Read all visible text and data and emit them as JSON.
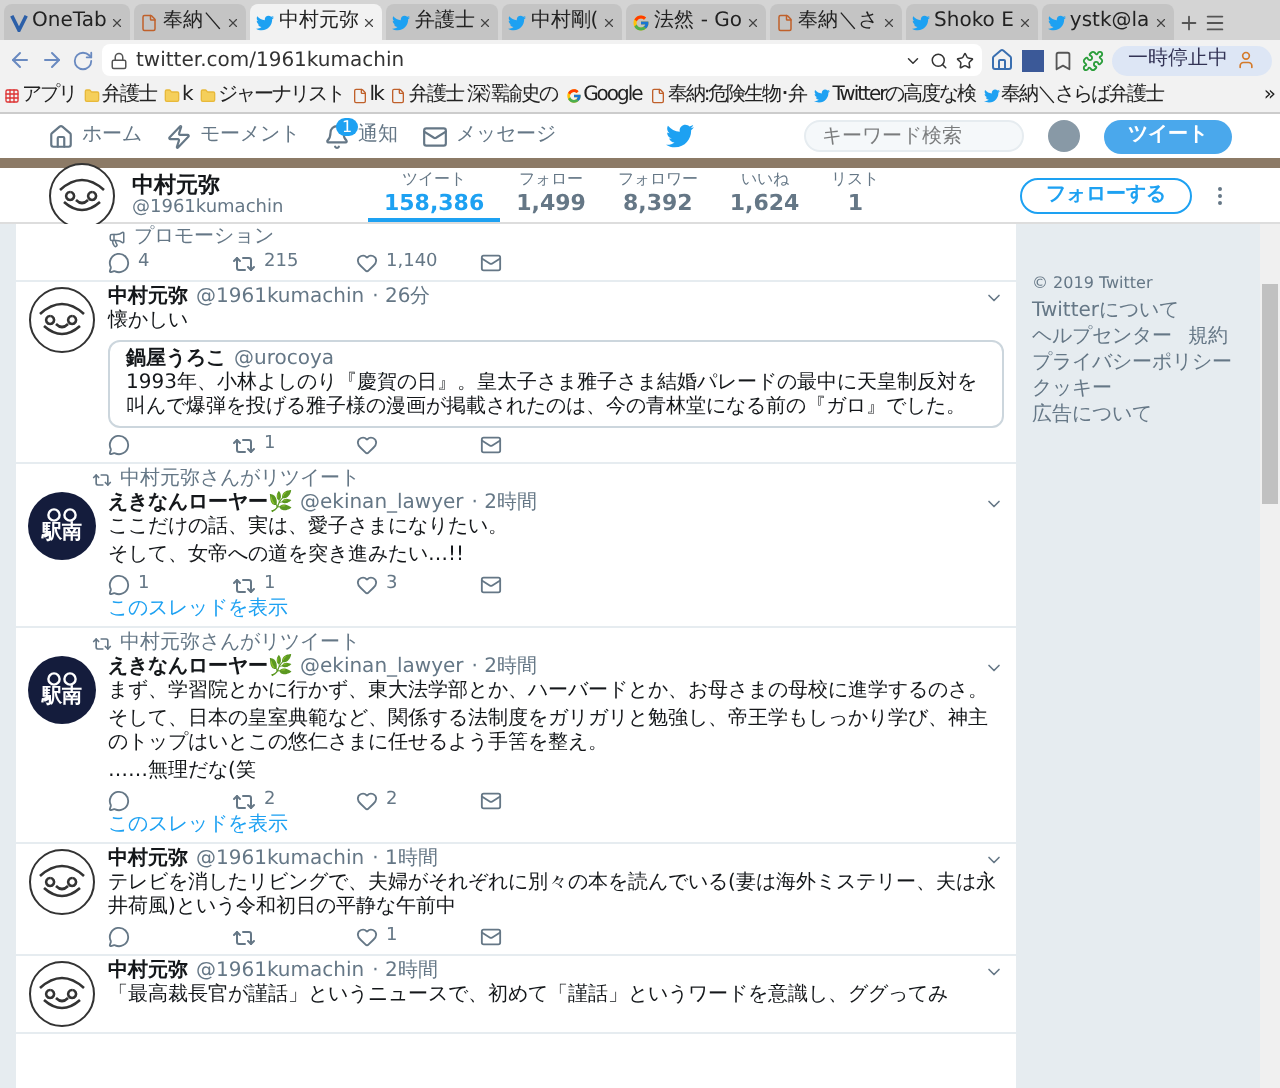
{
  "browser": {
    "tabs": [
      {
        "title": "OneTab",
        "kind": "onetab",
        "selected": false
      },
      {
        "title": "奉納＼",
        "kind": "page",
        "selected": false
      },
      {
        "title": "中村元弥",
        "kind": "twitter",
        "selected": true
      },
      {
        "title": "弁護士",
        "kind": "twitter",
        "selected": false
      },
      {
        "title": "中村剛(",
        "kind": "twitter",
        "selected": false
      },
      {
        "title": "法然 - Go",
        "kind": "google",
        "selected": false
      },
      {
        "title": "奉納＼さ",
        "kind": "page",
        "selected": false
      },
      {
        "title": "Shoko E",
        "kind": "twitter",
        "selected": false
      },
      {
        "title": "ystk@la",
        "kind": "twitter",
        "selected": false
      }
    ],
    "address": "twitter.com/1961kumachin",
    "pause_label": "一時停止中",
    "bookmarks": [
      {
        "label": "アプリ",
        "kind": "apps"
      },
      {
        "label": "弁護士",
        "kind": "folder"
      },
      {
        "label": "k",
        "kind": "folder"
      },
      {
        "label": "ジャーナリスト",
        "kind": "folder"
      },
      {
        "label": "lk",
        "kind": "page"
      },
      {
        "label": "弁護士 深澤諭史の",
        "kind": "page"
      },
      {
        "label": "Google",
        "kind": "google"
      },
      {
        "label": "奉納:危険生物･弁",
        "kind": "page"
      },
      {
        "label": "Twitterの高度な検",
        "kind": "twitter"
      },
      {
        "label": "奉納＼さらば弁護士",
        "kind": "twitter"
      }
    ],
    "bookmarks_more": "»"
  },
  "nav": {
    "items": [
      {
        "label": "ホーム",
        "kind": "home"
      },
      {
        "label": "モーメント",
        "kind": "moments"
      },
      {
        "label": "通知",
        "kind": "bell",
        "badge": "1"
      },
      {
        "label": "メッセージ",
        "kind": "mail"
      }
    ],
    "search": {
      "placeholder": "キーワード検索"
    },
    "tweet_button": "ツイート"
  },
  "profile": {
    "name": "中村元弥",
    "handle": "@1961kumachin",
    "stats": [
      {
        "label": "ツイート",
        "value": "158,386",
        "selected": true
      },
      {
        "label": "フォロー",
        "value": "1,499",
        "selected": false
      },
      {
        "label": "フォロワー",
        "value": "8,392",
        "selected": false
      },
      {
        "label": "いいね",
        "value": "1,624",
        "selected": false
      },
      {
        "label": "リスト",
        "value": "1",
        "selected": false
      }
    ],
    "follow_button": "フォローする"
  },
  "timeline": [
    {
      "kind": "promo",
      "promo_label": "プロモーション",
      "actions": [
        {
          "kind": "reply",
          "count": "4"
        },
        {
          "kind": "retweet",
          "count": "215"
        },
        {
          "kind": "like",
          "count": "1,140"
        },
        {
          "kind": "dm"
        }
      ]
    },
    {
      "kind": "tweet",
      "avatar": {
        "kind": "cartoon"
      },
      "name": "中村元弥",
      "handle": "@1961kumachin",
      "time": "· 26分",
      "paragraphs": [
        "懐かしい"
      ],
      "quote": {
        "name": "鍋屋うろこ",
        "handle": "@urocoya",
        "text": "1993年、小林よしのり『慶賀の日』。皇太子さま雅子さま結婚パレードの最中に天皇制反対を叫んで爆弾を投げる雅子様の漫画が掲載されたのは、今の青林堂になる前の『ガロ』でした。"
      },
      "actions": [
        {
          "kind": "reply"
        },
        {
          "kind": "retweet",
          "count": "1"
        },
        {
          "kind": "like"
        },
        {
          "kind": "dm"
        }
      ]
    },
    {
      "kind": "tweet",
      "retweeted_by": "中村元弥さんがリツイート",
      "avatar": {
        "kind": "badge",
        "label": "駅南"
      },
      "name": "えきなんローヤー🌿",
      "handle": "@ekinan_lawyer",
      "time": "· 2時間",
      "paragraphs": [
        "ここだけの話、実は、愛子さまになりたい。",
        "そして、女帝への道を突き進みたい…!!"
      ],
      "actions": [
        {
          "kind": "reply",
          "count": "1"
        },
        {
          "kind": "retweet",
          "count": "1"
        },
        {
          "kind": "like",
          "count": "3"
        },
        {
          "kind": "dm"
        }
      ],
      "thread_link": "このスレッドを表示"
    },
    {
      "kind": "tweet",
      "retweeted_by": "中村元弥さんがリツイート",
      "avatar": {
        "kind": "badge",
        "label": "駅南"
      },
      "name": "えきなんローヤー🌿",
      "handle": "@ekinan_lawyer",
      "time": "· 2時間",
      "paragraphs": [
        "まず、学習院とかに行かず、東大法学部とか、ハーバードとか、お母さまの母校に進学するのさ。",
        "そして、日本の皇室典範など、関係する法制度をガリガリと勉強し、帝王学もしっかり学び、神主のトップはいとこの悠仁さまに任せるよう手筈を整え。",
        "……無理だな(笑"
      ],
      "actions": [
        {
          "kind": "reply"
        },
        {
          "kind": "retweet",
          "count": "2"
        },
        {
          "kind": "like",
          "count": "2"
        },
        {
          "kind": "dm"
        }
      ],
      "thread_link": "このスレッドを表示"
    },
    {
      "kind": "tweet",
      "avatar": {
        "kind": "cartoon"
      },
      "name": "中村元弥",
      "handle": "@1961kumachin",
      "time": "· 1時間",
      "paragraphs": [
        "テレビを消したリビングで、夫婦がそれぞれに別々の本を読んでいる(妻は海外ミステリー、夫は永井荷風)という令和初日の平静な午前中"
      ],
      "actions": [
        {
          "kind": "reply"
        },
        {
          "kind": "retweet"
        },
        {
          "kind": "like",
          "count": "1"
        },
        {
          "kind": "dm"
        }
      ]
    },
    {
      "kind": "tweet",
      "avatar": {
        "kind": "cartoon"
      },
      "name": "中村元弥",
      "handle": "@1961kumachin",
      "time": "· 2時間",
      "paragraphs": [
        "「最高裁長官が謹話」というニュースで、初めて「謹話」というワードを意識し、ググってみ"
      ]
    }
  ],
  "footer": {
    "copyright": "© 2019 Twitter",
    "links": [
      "Twitterについて",
      "ヘルプセンター",
      "規約",
      "プライバシーポリシー",
      "クッキー",
      "広告について"
    ]
  }
}
